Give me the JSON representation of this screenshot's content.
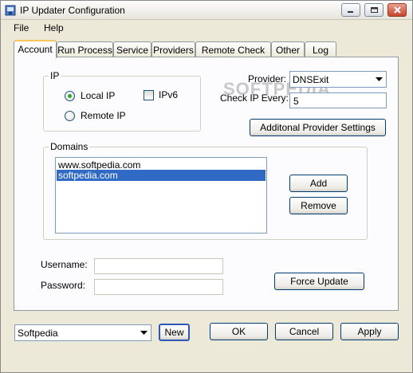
{
  "window": {
    "title": "IP Updater Configuration",
    "minimize_icon": "minimize-icon",
    "maximize_icon": "maximize-icon",
    "close_icon": "close-icon"
  },
  "menu": [
    "File",
    "Help"
  ],
  "tabs": [
    "Account",
    "Run Process",
    "Service",
    "Providers",
    "Remote Check IP",
    "Other",
    "Log"
  ],
  "ip_group": {
    "label": "IP",
    "local_ip": "Local IP",
    "remote_ip": "Remote IP",
    "ipv6": "IPv6"
  },
  "provider": {
    "label": "Provider:",
    "value": "DNSExit",
    "check_label": "Check IP Every:",
    "check_value": "5",
    "settings_button": "Additonal Provider Settings"
  },
  "domains": {
    "label": "Domains",
    "items": [
      "www.softpedia.com",
      "softpedia.com"
    ],
    "add_button": "Add",
    "remove_button": "Remove"
  },
  "credentials": {
    "username_label": "Username:",
    "password_label": "Password:",
    "username_value": "",
    "password_value": ""
  },
  "force_update_button": "Force Update",
  "profile": {
    "value": "Softpedia",
    "new_button": "New"
  },
  "actions": {
    "ok": "OK",
    "cancel": "Cancel",
    "apply": "Apply"
  },
  "watermark": "SOFTPEDIA",
  "colors": {
    "accent": "#316ac5",
    "tab_highlight": "#f6c55c",
    "window_bg": "#ece9d8"
  }
}
